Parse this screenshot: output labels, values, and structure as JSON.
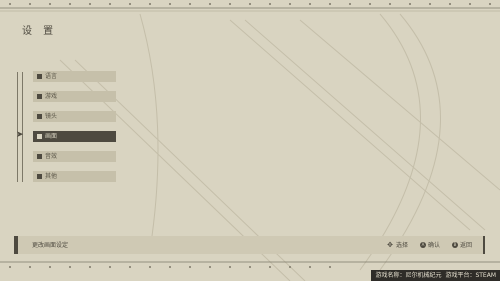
{
  "page": {
    "title": "设 置"
  },
  "menu": {
    "items": [
      {
        "label": "语言",
        "active": false
      },
      {
        "label": "游戏",
        "active": false
      },
      {
        "label": "镜头",
        "active": false
      },
      {
        "label": "画面",
        "active": true
      },
      {
        "label": "音效",
        "active": false
      },
      {
        "label": "其他",
        "active": false
      }
    ]
  },
  "status": {
    "description": "更改画面设定",
    "hints": [
      {
        "icon": "dpad-icon",
        "label": "选择"
      },
      {
        "icon": "a-button-icon",
        "glyph": "A",
        "label": "确认"
      },
      {
        "icon": "b-button-icon",
        "glyph": "B",
        "label": "返回"
      }
    ]
  },
  "info_bar": {
    "game_name": "游戏名称：尼尔机械纪元",
    "platform": "游戏平台：STEAM"
  },
  "colors": {
    "background": "#d9d4c1",
    "ink": "#4e4a40",
    "item_bg": "#c6c0aa",
    "info_bar_bg": "#2e2c28"
  }
}
